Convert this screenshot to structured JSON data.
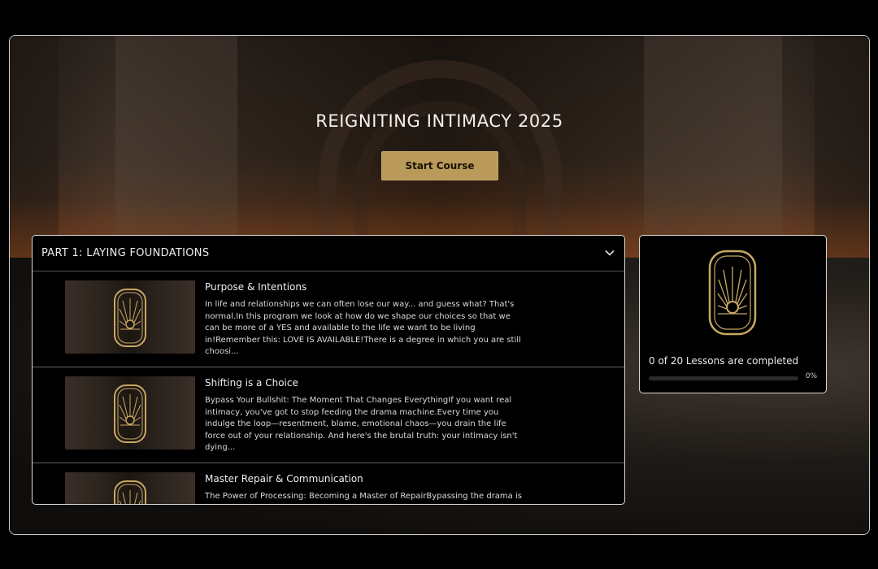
{
  "hero": {
    "title": "REIGNITING INTIMACY 2025",
    "start_button": "Start Course"
  },
  "section": {
    "title": "PART 1: LAYING FOUNDATIONS",
    "toggle_icon": "chevron-down-icon",
    "lessons": [
      {
        "title": "Purpose & Intentions",
        "description": "In life and relationships we can often lose our way... and guess what? That's normal.In this program we look at how do we shape our choices so that we can be more of a YES and available to the life we want to be living in!Remember this: LOVE IS AVAILABLE!There is a degree in which you are still choosi..."
      },
      {
        "title": "Shifting is a Choice",
        "description": "Bypass Your Bullshit: The Moment That Changes EverythingIf you want real intimacy, you've got to stop feeding the drama machine.Every time you indulge the loop—resentment, blame, emotional chaos—you drain the life force out of your relationship. And here's the brutal truth: your intimacy isn't dying..."
      },
      {
        "title": "Master Repair & Communication",
        "description": "The Power of Processing: Becoming a Master of RepairBypassing the drama is"
      }
    ]
  },
  "progress": {
    "text": "0 of 20 Lessons are completed",
    "percent_label": "0%",
    "percent_value": 0
  },
  "colors": {
    "accent_gold": "#b99a58",
    "panel_bg": "#000000"
  }
}
